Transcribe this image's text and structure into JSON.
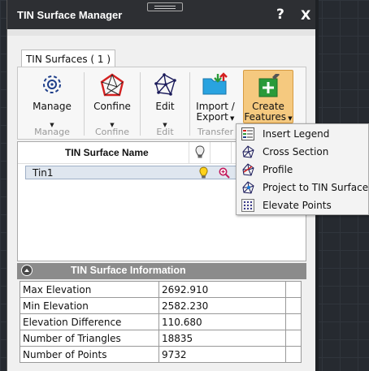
{
  "window": {
    "title": "TIN Surface Manager",
    "help": "?",
    "close": "X"
  },
  "tabs": [
    {
      "label": "TIN Surfaces ( 1 )"
    }
  ],
  "ribbon": {
    "manage": {
      "label": "Manage",
      "group": "Manage"
    },
    "confine": {
      "label": "Confine",
      "group": "Confine"
    },
    "edit": {
      "label": "Edit",
      "group": "Edit"
    },
    "import_export": {
      "label_line1": "Import /",
      "label_line2": "Export",
      "group": "Transfer"
    },
    "create": {
      "label_line1": "Create",
      "label_line2": "Features"
    }
  },
  "grid": {
    "header": {
      "name": "TIN Surface Name"
    },
    "rows": [
      {
        "name": "Tin1"
      }
    ]
  },
  "info": {
    "title": "TIN Surface Information",
    "rows": [
      {
        "label": "Max Elevation",
        "value": "2692.910"
      },
      {
        "label": "Min Elevation",
        "value": "2582.230"
      },
      {
        "label": "Elevation Difference",
        "value": "110.680"
      },
      {
        "label": "Number of Triangles",
        "value": "18835"
      },
      {
        "label": "Number of Points",
        "value": "9732"
      }
    ]
  },
  "menu": {
    "items": [
      {
        "label": "Insert Legend",
        "icon": "legend-icon"
      },
      {
        "label": "Cross Section",
        "icon": "cross-section-icon"
      },
      {
        "label": "Profile",
        "icon": "profile-icon"
      },
      {
        "label": "Project to TIN Surface",
        "icon": "project-tin-icon"
      },
      {
        "label": "Elevate Points",
        "icon": "elevate-points-icon"
      }
    ]
  },
  "colors": {
    "accent": "#f5c97f",
    "titlebar": "#2d2f33",
    "selection": "#dfe6ef"
  }
}
